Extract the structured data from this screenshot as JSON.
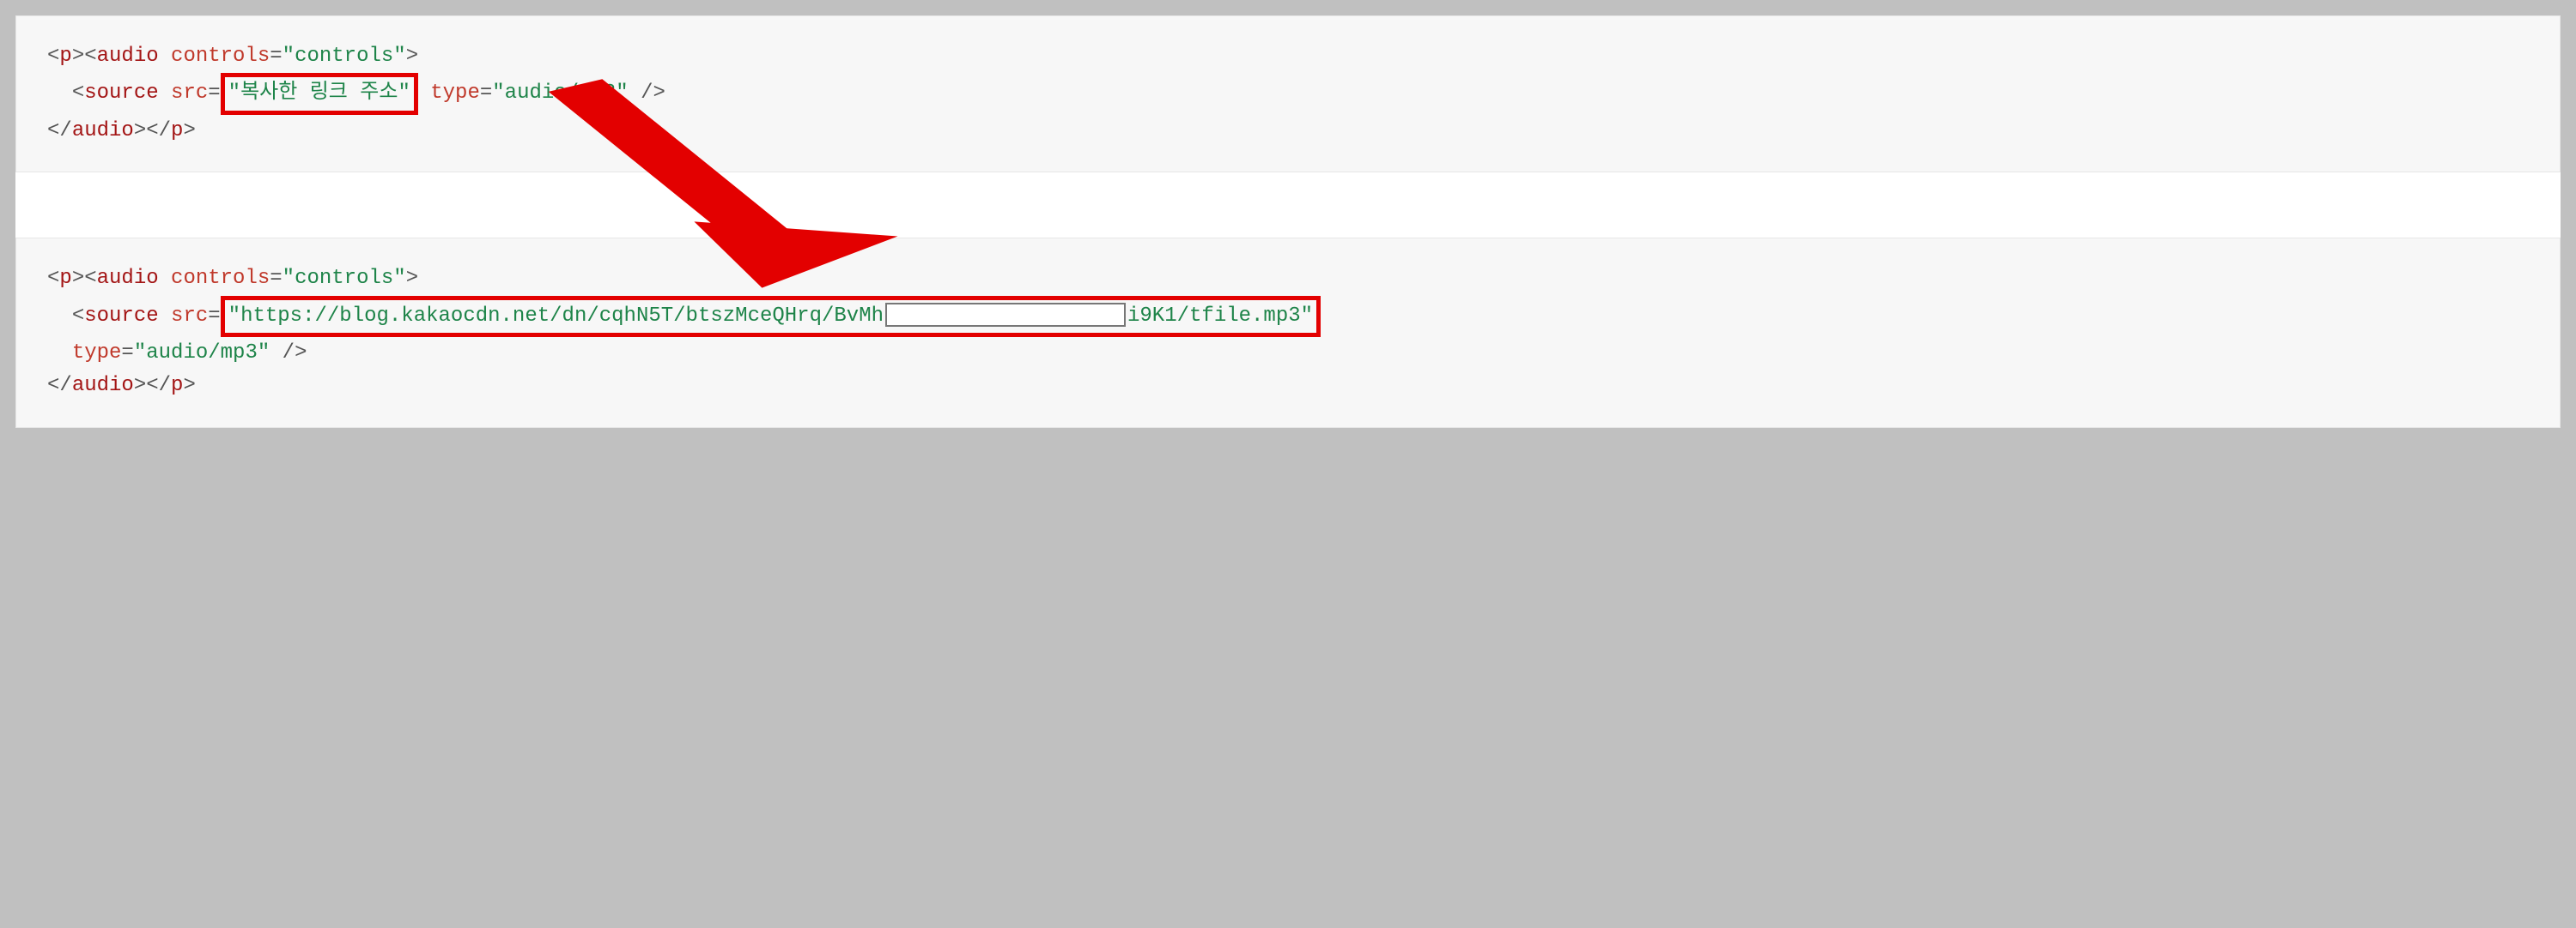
{
  "block1": {
    "p_open": "<p>",
    "audio_open_tag": "audio",
    "controls_attr": "controls",
    "controls_val": "\"controls\"",
    "gt": ">",
    "source_tag": "source",
    "src_attr": "src",
    "placeholder_val": "\"복사한 링크 주소\"",
    "type_attr": "type",
    "type_val": "\"audio/mp3\"",
    "self_close": " />",
    "audio_close": "</audio>",
    "p_close": "</p>"
  },
  "block2": {
    "p_open": "<p>",
    "audio_open_tag": "audio",
    "controls_attr": "controls",
    "controls_val": "\"controls\"",
    "gt": ">",
    "source_tag": "source",
    "src_attr": "src",
    "url_left": "\"https://blog.kakaocdn.net/dn/cqhN5T/btszMceQHrq/BvMh",
    "url_right": "i9K1/tfile.mp3\"",
    "type_attr": "type",
    "type_val": "\"audio/mp3\"",
    "self_close": " />",
    "audio_close": "</audio>",
    "p_close": "</p>"
  }
}
